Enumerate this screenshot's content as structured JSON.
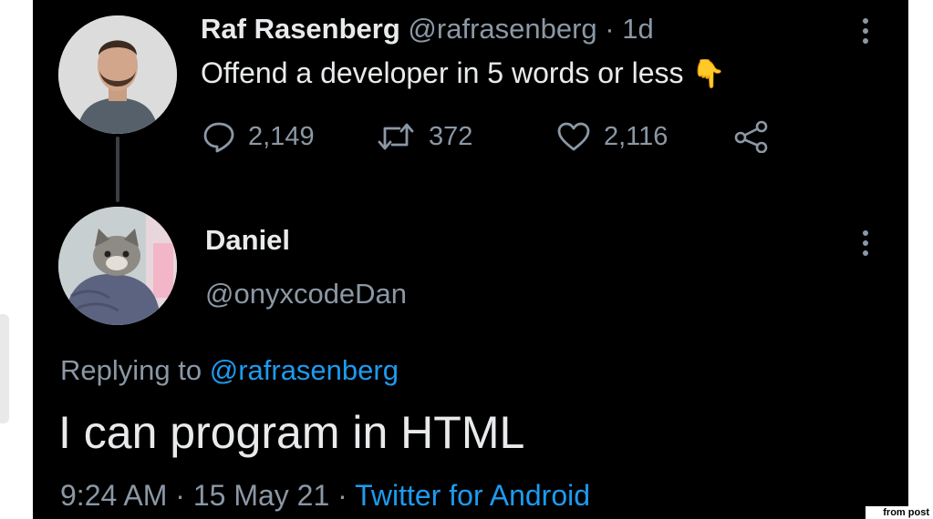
{
  "original_tweet": {
    "display_name": "Raf Rasenberg",
    "handle": "@rafrasenberg",
    "separator": "·",
    "age": "1d",
    "text": "Offend a developer in 5 words or less",
    "emoji": "👇",
    "stats": {
      "replies": "2,149",
      "retweets": "372",
      "likes": "2,116"
    }
  },
  "reply_tweet": {
    "display_name": "Daniel",
    "handle": "@onyxcodeDan",
    "replying_prefix": "Replying to",
    "replying_handle": "@rafrasenberg",
    "text": "I can program in HTML",
    "time": "9:24 AM",
    "separator": "·",
    "date": "15 May 21",
    "source": "Twitter for Android"
  },
  "watermark": "from post",
  "colors": {
    "background": "#000000",
    "text": "#e8eaec",
    "secondary": "#8b98a5",
    "accent": "#1d9bf0"
  },
  "icons": [
    "reply-icon",
    "retweet-icon",
    "like-icon",
    "share-icon",
    "more-options-icon"
  ]
}
